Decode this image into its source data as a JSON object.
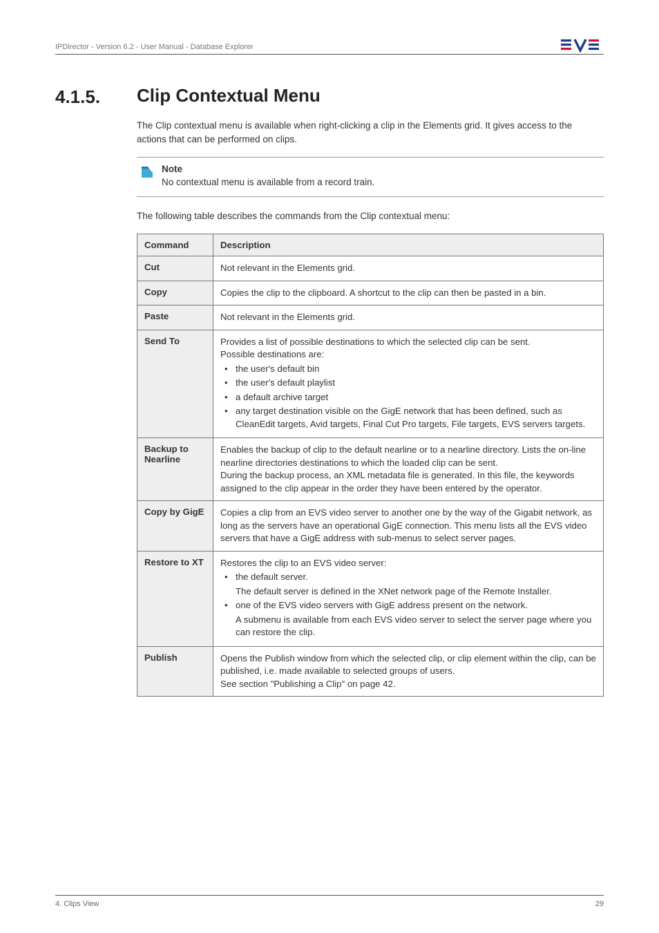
{
  "header": {
    "left": "IPDirector - Version 6.2 - User Manual - Database Explorer"
  },
  "section": {
    "number": "4.1.5.",
    "title": "Clip Contextual Menu"
  },
  "intro": "The Clip contextual menu is available when right-clicking a clip in the Elements grid. It gives access to the actions that can be performed on clips.",
  "note": {
    "title": "Note",
    "body": "No contextual menu is available from a record train."
  },
  "table_intro": "The following table describes the commands from the Clip contextual menu:",
  "table": {
    "head": {
      "c1": "Command",
      "c2": "Description"
    },
    "rows": {
      "cut": {
        "c1": "Cut",
        "c2": "Not relevant in the Elements grid."
      },
      "copy": {
        "c1": "Copy",
        "c2": "Copies the clip to the clipboard. A shortcut to the clip can then be pasted in a bin."
      },
      "paste": {
        "c1": "Paste",
        "c2": "Not relevant in the Elements grid."
      },
      "sendto": {
        "c1": "Send To",
        "pre": "Provides a list of possible destinations to which the selected clip can be sent.",
        "pre2": "Possible destinations are:",
        "items": [
          "the user's default bin",
          "the user's default playlist",
          "a default archive target",
          "any target destination visible on the GigE network that has been defined, such as CleanEdit targets, Avid targets, Final Cut Pro targets, File targets, EVS servers targets."
        ]
      },
      "backup": {
        "c1": "Backup to Nearline",
        "c2": "Enables the backup of clip to the default nearline or to a nearline directory. Lists the on-line nearline directories destinations to which the loaded clip can be sent.\nDuring the backup process, an XML metadata file is generated. In this file, the keywords assigned to the clip appear in the order they have been entered by the operator."
      },
      "copyby": {
        "c1": "Copy by GigE",
        "c2": "Copies a clip from an EVS video server to another one by the way of the Gigabit network, as long as the servers have an operational GigE connection. This menu lists all the EVS video servers that have a GigE address with sub-menus to select server pages."
      },
      "restore": {
        "c1": "Restore to XT",
        "pre": "Restores the clip to an EVS video server:",
        "items": [
          {
            "t": "the default server.",
            "cont": [
              "The default server is defined in the XNet network page of the Remote Installer."
            ]
          },
          {
            "t": "one of the EVS video servers with GigE address present on the network.",
            "cont": [
              "A submenu is available from each EVS video server to select the server page where you can restore the clip."
            ]
          }
        ]
      },
      "publish": {
        "c1": "Publish",
        "c2": "Opens the Publish window from which the selected clip, or clip element within the clip, can be published, i.e. made available to selected groups of users.\nSee section \"Publishing a Clip\" on page 42."
      }
    }
  },
  "footer": {
    "left": "4. Clips View",
    "right": "29"
  }
}
